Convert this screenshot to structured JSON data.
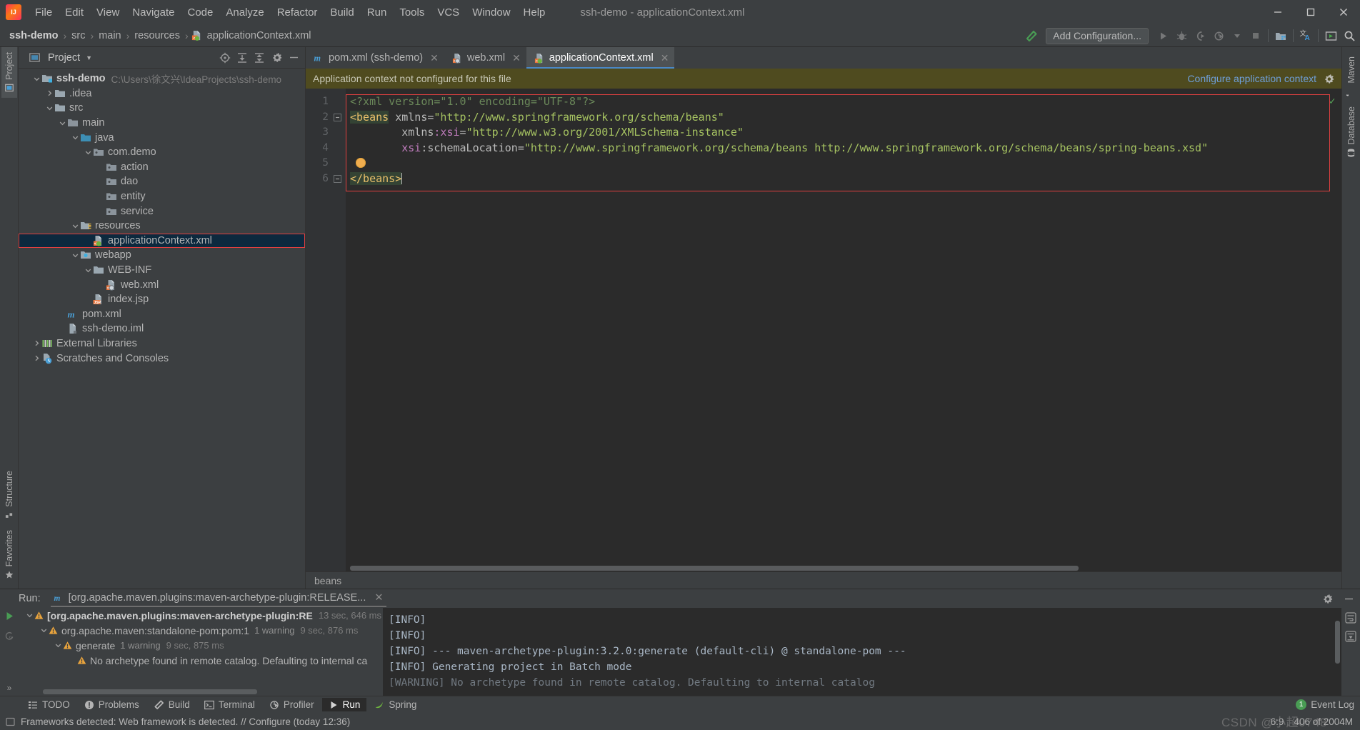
{
  "window": {
    "title": "ssh-demo - applicationContext.xml",
    "minimize": "−",
    "maximize": "□",
    "close": "✕"
  },
  "menu": {
    "items": [
      {
        "label": "File"
      },
      {
        "label": "Edit"
      },
      {
        "label": "View"
      },
      {
        "label": "Navigate"
      },
      {
        "label": "Code"
      },
      {
        "label": "Analyze"
      },
      {
        "label": "Refactor"
      },
      {
        "label": "Build"
      },
      {
        "label": "Run"
      },
      {
        "label": "Tools"
      },
      {
        "label": "VCS"
      },
      {
        "label": "Window"
      },
      {
        "label": "Help"
      }
    ]
  },
  "navbar": {
    "crumbs": [
      "ssh-demo",
      "src",
      "main",
      "resources",
      "applicationContext.xml"
    ],
    "separator": "›",
    "add_configuration": "Add Configuration...",
    "icons": [
      "build-hammer-icon",
      "run-icon",
      "debug-icon",
      "run-coverage-icon",
      "profile-icon",
      "dropdown-icon",
      "stop-icon",
      "project-structure-icon",
      "translate-icon",
      "presentation-icon",
      "search-icon"
    ]
  },
  "left_rail": {
    "project_tab": "Project",
    "structure_tab": "Structure",
    "favorites_tab": "Favorites"
  },
  "right_rail": {
    "maven_tab": "Maven",
    "database_tab": "Database"
  },
  "project_panel": {
    "title": "Project",
    "toolbar_icons": [
      "locate-icon",
      "expand-all-icon",
      "collapse-all-icon",
      "gear-icon",
      "hide-icon"
    ],
    "tree": [
      {
        "label": "ssh-demo",
        "path": "C:\\Users\\徐文兴\\IdeaProjects\\ssh-demo",
        "depth": 0,
        "arrow": "down",
        "icon": "module-folder-icon",
        "bold": true
      },
      {
        "label": ".idea",
        "depth": 1,
        "arrow": "right",
        "icon": "folder-icon"
      },
      {
        "label": "src",
        "depth": 1,
        "arrow": "down",
        "icon": "folder-icon"
      },
      {
        "label": "main",
        "depth": 2,
        "arrow": "down",
        "icon": "folder-grey-icon"
      },
      {
        "label": "java",
        "depth": 3,
        "arrow": "down",
        "icon": "source-folder-icon"
      },
      {
        "label": "com.demo",
        "depth": 4,
        "arrow": "down",
        "icon": "package-icon"
      },
      {
        "label": "action",
        "depth": 5,
        "arrow": "none",
        "icon": "package-icon"
      },
      {
        "label": "dao",
        "depth": 5,
        "arrow": "none",
        "icon": "package-icon"
      },
      {
        "label": "entity",
        "depth": 5,
        "arrow": "none",
        "icon": "package-icon"
      },
      {
        "label": "service",
        "depth": 5,
        "arrow": "none",
        "icon": "package-icon"
      },
      {
        "label": "resources",
        "depth": 3,
        "arrow": "down",
        "icon": "resources-folder-icon"
      },
      {
        "label": "applicationContext.xml",
        "depth": 4,
        "arrow": "none",
        "icon": "spring-xml-icon",
        "selected": true,
        "highlighted": true
      },
      {
        "label": "webapp",
        "depth": 3,
        "arrow": "down",
        "icon": "webapp-folder-icon"
      },
      {
        "label": "WEB-INF",
        "depth": 4,
        "arrow": "down",
        "icon": "folder-icon"
      },
      {
        "label": "web.xml",
        "depth": 5,
        "arrow": "none",
        "icon": "web-xml-icon"
      },
      {
        "label": "index.jsp",
        "depth": 4,
        "arrow": "none",
        "icon": "jsp-icon"
      },
      {
        "label": "pom.xml",
        "depth": 2,
        "arrow": "none",
        "icon": "maven-icon"
      },
      {
        "label": "ssh-demo.iml",
        "depth": 2,
        "arrow": "none",
        "icon": "iml-icon"
      },
      {
        "label": "External Libraries",
        "depth": 0,
        "arrow": "right",
        "icon": "libraries-icon"
      },
      {
        "label": "Scratches and Consoles",
        "depth": 0,
        "arrow": "right",
        "icon": "scratches-icon"
      }
    ]
  },
  "editor": {
    "tabs": [
      {
        "label": "pom.xml (ssh-demo)",
        "icon": "maven-icon",
        "active": false,
        "close": "✕"
      },
      {
        "label": "web.xml",
        "icon": "web-xml-icon",
        "active": false,
        "close": "✕"
      },
      {
        "label": "applicationContext.xml",
        "icon": "spring-xml-icon",
        "active": true,
        "close": "✕"
      }
    ],
    "notification": {
      "message": "Application context not configured for this file",
      "action": "Configure application context",
      "gear": "gear-icon"
    },
    "line_numbers": [
      "1",
      "2",
      "3",
      "4",
      "5",
      "6"
    ],
    "lines": [
      {
        "n": 1,
        "segments": [
          {
            "t": "<?xml version=\"1.0\" encoding=\"UTF-8\"?>",
            "c": "k-pi"
          }
        ]
      },
      {
        "n": 2,
        "segments": [
          {
            "t": "<beans",
            "c": "k-tag hl-tag"
          },
          {
            "t": " xmlns",
            "c": "k-attr"
          },
          {
            "t": "=",
            "c": "k-punc"
          },
          {
            "t": "\"http://www.springframework.org/schema/beans\"",
            "c": "k-val"
          }
        ]
      },
      {
        "n": 3,
        "segments": [
          {
            "t": "        xmlns",
            "c": "k-attr"
          },
          {
            "t": ":xsi",
            "c": "k-ns"
          },
          {
            "t": "=",
            "c": "k-punc"
          },
          {
            "t": "\"http://www.w3.org/2001/XMLSchema-instance\"",
            "c": "k-val"
          }
        ]
      },
      {
        "n": 4,
        "segments": [
          {
            "t": "        xsi",
            "c": "k-ns"
          },
          {
            "t": ":schemaLocation",
            "c": "k-attr"
          },
          {
            "t": "=",
            "c": "k-punc"
          },
          {
            "t": "\"http://www.springframework.org/schema/beans http://www.springframework.org/schema/beans/spring-beans.xsd\"",
            "c": "k-val"
          }
        ]
      },
      {
        "n": 5,
        "segments": []
      },
      {
        "n": 6,
        "segments": [
          {
            "t": "</beans>",
            "c": "k-tag hl-tag"
          }
        ]
      }
    ],
    "breadcrumb": "beans",
    "status_check": "✓"
  },
  "run_panel": {
    "label": "Run:",
    "tab_title": "[org.apache.maven.plugins:maven-archetype-plugin:RELEASE...",
    "tab_close": "✕",
    "tab_icon": "maven-icon",
    "settings_icon": "gear-icon",
    "hide_icon": "hide-icon",
    "tree": [
      {
        "label": "[org.apache.maven.plugins:maven-archetype-plugin:RE",
        "duration": "13 sec, 646 ms",
        "warnings": "",
        "depth": 0,
        "arrow": "down",
        "bold": true
      },
      {
        "label": "org.apache.maven:standalone-pom:pom:1",
        "duration": "9 sec, 876 ms",
        "warnings": "1 warning",
        "depth": 1,
        "arrow": "down",
        "bold": false
      },
      {
        "label": "generate",
        "duration": "9 sec, 875 ms",
        "warnings": "1 warning",
        "depth": 2,
        "arrow": "down",
        "bold": false
      },
      {
        "label": "No archetype found in remote catalog. Defaulting to internal ca",
        "duration": "",
        "warnings": "",
        "depth": 3,
        "arrow": "none",
        "bold": false
      }
    ],
    "console": [
      "[INFO]",
      "[INFO]",
      "[INFO] --- maven-archetype-plugin:3.2.0:generate (default-cli) @ standalone-pom ---",
      "[INFO] Generating project in Batch mode",
      "[WARNING] No archetype found in remote catalog. Defaulting to internal catalog"
    ]
  },
  "bottom_bar": {
    "tabs": [
      {
        "label": "TODO",
        "icon": "todo-icon",
        "active": false
      },
      {
        "label": "Problems",
        "icon": "problems-icon",
        "active": false
      },
      {
        "label": "Build",
        "icon": "build-hammer-icon",
        "active": false
      },
      {
        "label": "Terminal",
        "icon": "terminal-icon",
        "active": false
      },
      {
        "label": "Profiler",
        "icon": "profiler-icon",
        "active": false
      },
      {
        "label": "Run",
        "icon": "run-icon",
        "active": true
      },
      {
        "label": "Spring",
        "icon": "spring-icon",
        "active": false
      }
    ],
    "event_log": "Event Log",
    "event_count": "1"
  },
  "status_bar": {
    "message": "Frameworks detected: Web framework is detected. // Configure (today 12:36)",
    "caret_position": "6:9",
    "memory": "406 of 2004M",
    "watermark": "CSDN @小超0748"
  },
  "colors": {
    "accent_blue": "#4a88c7",
    "notification_bg": "#4f4b1f",
    "selection_bg": "#0d293e",
    "highlight_red": "#e04040",
    "warning_orange": "#e8a33d",
    "run_green": "#499c54"
  }
}
